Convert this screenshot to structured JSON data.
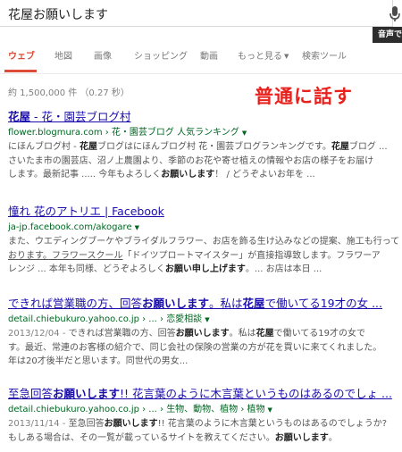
{
  "search": {
    "query": "花屋お願いします",
    "tooltip": "音声で"
  },
  "tabs": [
    {
      "label": "ウェブ",
      "active": true
    },
    {
      "label": "地図"
    },
    {
      "label": "画像"
    },
    {
      "label": "ショッピング"
    },
    {
      "label": "動画"
    },
    {
      "label": "もっと見る",
      "dropdown": true
    },
    {
      "label": "検索ツール"
    }
  ],
  "stats": "約 1,500,000 件 （0.27 秒）",
  "annotation": "普通に話す",
  "results": [
    {
      "title_parts": [
        {
          "text": "花屋",
          "b": true
        },
        {
          "text": " - 花・園芸ブログ村"
        }
      ],
      "url": "flower.blogmura.com › 花・園芸ブログ 人気ランキング",
      "snippet_lines": [
        [
          {
            "text": "にほんブログ村 - "
          },
          {
            "text": "花屋",
            "b": true
          },
          {
            "text": "ブログはにほんブログ村 花・園芸ブログランキングです。"
          },
          {
            "text": "花屋",
            "b": true
          },
          {
            "text": "ブログ ..."
          }
        ],
        [
          {
            "text": "さいたま市の園芸店、沼ノ上農園より、季節のお花や寄せ植えの情報やお店の様子をお届け"
          }
        ],
        [
          {
            "text": "します。最新記事 ..... 今年もよろしく"
          },
          {
            "text": "お願いします",
            "b": true
          },
          {
            "text": "！ / どうぞよいお年を ..."
          }
        ]
      ]
    },
    {
      "title_parts": [
        {
          "text": "憧れ 花のアトリエ | Facebook"
        }
      ],
      "url": "ja-jp.facebook.com/akogare",
      "snippet_lines": [
        [
          {
            "text": "また、ウエディングブーケやブライダルフラワー、お店を飾る生け込みなどの提案、施工も行って"
          }
        ],
        [
          {
            "text": "おります。フラワースクール",
            "u": true
          },
          {
            "text": "「ドイツプロートマイスター」が直接指導致します。フラワーア"
          }
        ],
        [
          {
            "text": "レンジ ... 本年も同様、どうぞよろしく"
          },
          {
            "text": "お願い申し上げます",
            "b": true
          },
          {
            "text": "。... お店は本日 ..."
          }
        ]
      ]
    },
    {
      "title_parts": [
        {
          "text": "できれば営業職の方、回答"
        },
        {
          "text": "お願いします",
          "b": true
        },
        {
          "text": "。私は"
        },
        {
          "text": "花屋",
          "b": true
        },
        {
          "text": "で働いてる19才の女 ..."
        }
      ],
      "url": "detail.chiebukuro.yahoo.co.jp › ... › 恋愛相談",
      "snippet_lines": [
        [
          {
            "text": "2013/12/04 - ",
            "date": true
          },
          {
            "text": "できれば営業職の方、回答"
          },
          {
            "text": "お願いします",
            "b": true
          },
          {
            "text": "。私は"
          },
          {
            "text": "花屋",
            "b": true
          },
          {
            "text": "で働いてる19才の女で"
          }
        ],
        [
          {
            "text": "す。最近、常連のお客様の紹介で、同じ会社の保険の営業の方が花を買いに来てくれました。"
          }
        ],
        [
          {
            "text": "年は20才後半だと思います。同世代の男女..."
          }
        ]
      ]
    },
    {
      "title_parts": [
        {
          "text": "至急回答"
        },
        {
          "text": "お願いします",
          "b": true
        },
        {
          "text": "!! 花言葉のように木言葉というものはあるのでしょ ..."
        }
      ],
      "url": "detail.chiebukuro.yahoo.co.jp › ... › 生物、動物、植物 › 植物",
      "snippet_lines": [
        [
          {
            "text": "2013/11/14 - ",
            "date": true
          },
          {
            "text": "至急回答"
          },
          {
            "text": "お願いします",
            "b": true
          },
          {
            "text": "!! 花言葉のように木言葉というものはあるのでしょうか?"
          }
        ],
        [
          {
            "text": "もしある場合は、その一覧が載っているサイトを教えてください。"
          },
          {
            "text": "お願いします",
            "b": true
          },
          {
            "text": "。"
          }
        ]
      ]
    }
  ]
}
